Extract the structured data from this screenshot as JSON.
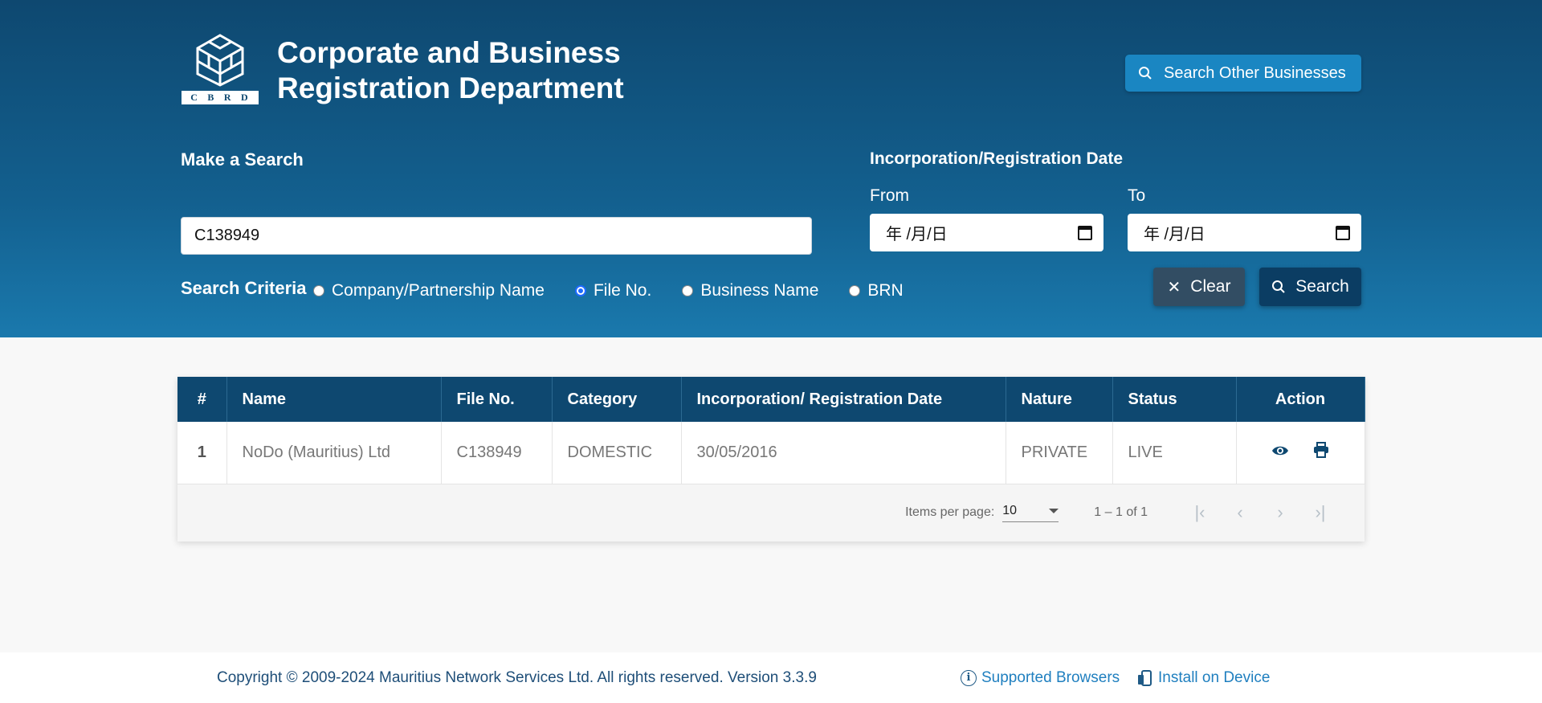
{
  "header": {
    "logo_letters": [
      "C",
      "B",
      "R",
      "D"
    ],
    "title_line1": "Corporate and Business",
    "title_line2": "Registration Department",
    "other_businesses_label": "Search Other Businesses"
  },
  "search": {
    "heading": "Make a Search",
    "query_value": "C138949",
    "criteria_label": "Search Criteria",
    "criteria": [
      {
        "label": "Company/Partnership Name",
        "checked": false
      },
      {
        "label": "File No.",
        "checked": true
      },
      {
        "label": "Business Name",
        "checked": false
      },
      {
        "label": "BRN",
        "checked": false
      }
    ],
    "date_heading": "Incorporation/Registration Date",
    "from_label": "From",
    "to_label": "To",
    "from_placeholder": "年 /月/日",
    "to_placeholder": "年 /月/日",
    "clear_label": "Clear",
    "search_label": "Search"
  },
  "table": {
    "columns": [
      "#",
      "Name",
      "File No.",
      "Category",
      "Incorporation/ Registration Date",
      "Nature",
      "Status",
      "Action"
    ],
    "rows": [
      {
        "num": "1",
        "name": "NoDo (Mauritius) Ltd",
        "file_no": "C138949",
        "category": "DOMESTIC",
        "date": "30/05/2016",
        "nature": "PRIVATE",
        "status": "LIVE"
      }
    ]
  },
  "pager": {
    "items_per_page_label": "Items per page:",
    "items_per_page_value": "10",
    "range_label": "1 – 1 of 1"
  },
  "footer": {
    "copyright": "Copyright © 2009-2024 Mauritius Network Services Ltd. All rights reserved. Version 3.3.9",
    "supported_browsers": "Supported Browsers",
    "install": "Install on Device"
  },
  "colors": {
    "header_gradient_top": "#0e4870",
    "header_gradient_bottom": "#1a79ad",
    "table_header": "#0e4870",
    "link": "#1f7fbf"
  }
}
